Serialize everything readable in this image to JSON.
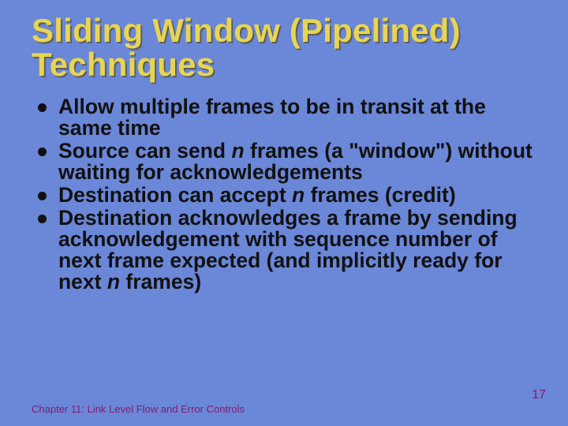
{
  "title": "Sliding Window (Pipelined) Techniques",
  "bullets": [
    {
      "pre": "Allow multiple frames to be in transit at the same time"
    },
    {
      "pre": "Source can send ",
      "ital": "n",
      "post": " frames (a \"window\") without waiting for acknowledgements"
    },
    {
      "pre": "Destination can accept ",
      "ital": "n",
      "post": " frames (credit)"
    },
    {
      "pre": "Destination acknowledges a frame by sending acknowledgement with sequence number of next frame expected (and implicitly ready for next ",
      "ital": "n",
      "post": " frames)"
    }
  ],
  "footer": "Chapter 11: Link Level Flow and Error Controls",
  "page": "17"
}
